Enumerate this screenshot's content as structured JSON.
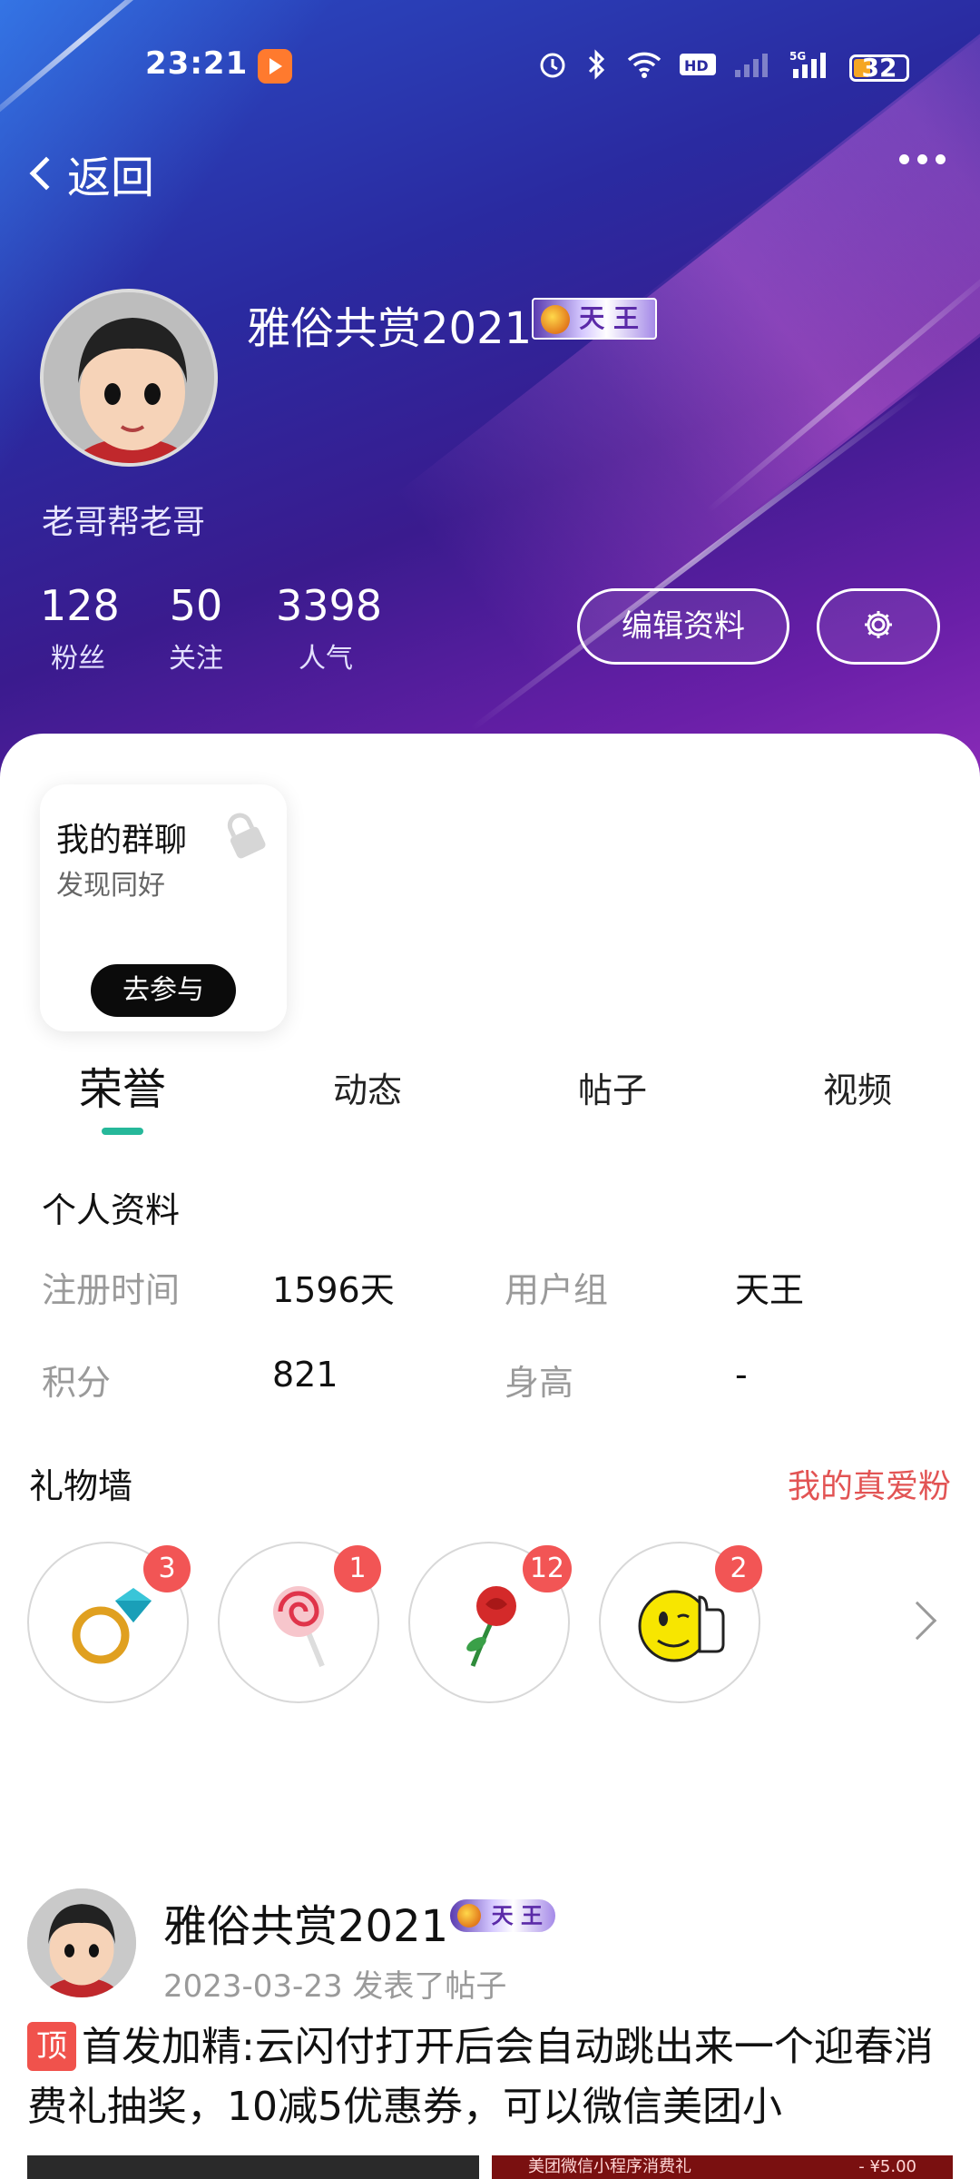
{
  "status_bar": {
    "time": "23:21",
    "battery": "32"
  },
  "nav": {
    "back_label": "返回"
  },
  "profile": {
    "username": "雅俗共赏2021",
    "badge": "天 王",
    "bio": "老哥帮老哥",
    "stats": [
      {
        "value": "128",
        "label": "粉丝"
      },
      {
        "value": "50",
        "label": "关注"
      },
      {
        "value": "3398",
        "label": "人气"
      }
    ],
    "edit_button": "编辑资料"
  },
  "group_card": {
    "title": "我的群聊",
    "subtitle": "发现同好",
    "join_button": "去参与"
  },
  "tabs": [
    "荣誉",
    "动态",
    "帖子",
    "视频"
  ],
  "personal_info": {
    "title": "个人资料",
    "rows": [
      {
        "label": "注册时间",
        "value": "1596天"
      },
      {
        "label": "用户组",
        "value": "天王"
      },
      {
        "label": "积分",
        "value": "821"
      },
      {
        "label": "身高",
        "value": "-"
      }
    ]
  },
  "gift_wall": {
    "title": "礼物墙",
    "link": "我的真爱粉",
    "gifts": [
      {
        "icon": "diamond-ring-icon",
        "count": "3"
      },
      {
        "icon": "lollipop-icon",
        "count": "1"
      },
      {
        "icon": "rose-icon",
        "count": "12"
      },
      {
        "icon": "thumbs-up-emoji-icon",
        "count": "2"
      }
    ]
  },
  "post": {
    "author": "雅俗共赏2021",
    "badge": "天 王",
    "meta": "2023-03-23  发表了帖子",
    "tag": "顶",
    "text": "首发加精:云闪付打开后会自动跳出来一个迎春消费礼抽奖，10减5优惠券，可以微信美团小",
    "image_caption": "美团微信小程序消费礼",
    "image_price": "- ¥5.00"
  },
  "colors": {
    "accent_green": "#26b89a",
    "link_red": "#e25454",
    "badge_red": "#f25555"
  }
}
